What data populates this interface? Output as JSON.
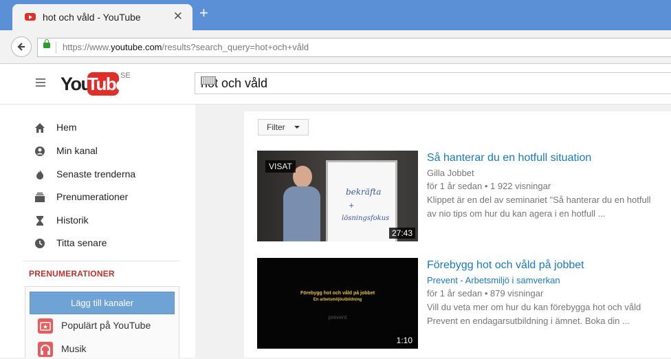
{
  "browser": {
    "tab_title": "hot och våld - YouTube",
    "tab_close": "✕",
    "new_tab": "+",
    "url_prefix": "https://www.",
    "url_domain": "youtube.com",
    "url_path": "/results?search_query=hot+och+våld"
  },
  "header": {
    "logo_you": "You",
    "logo_tube": "Tube",
    "logo_region": "SE",
    "search_value": "hot och våld"
  },
  "sidebar": {
    "items": [
      {
        "label": "Hem",
        "icon": "home-icon"
      },
      {
        "label": "Min kanal",
        "icon": "account-icon"
      },
      {
        "label": "Senaste trenderna",
        "icon": "flame-icon"
      },
      {
        "label": "Prenumerationer",
        "icon": "subscriptions-icon"
      },
      {
        "label": "Historik",
        "icon": "hourglass-icon"
      },
      {
        "label": "Titta senare",
        "icon": "clock-icon"
      }
    ],
    "subscriptions_heading": "PRENUMERATIONER",
    "add_channels_label": "Lägg till kanaler",
    "channels": [
      {
        "label": "Populärt på YouTube",
        "icon": "popular-icon"
      },
      {
        "label": "Musik",
        "icon": "headphones-icon"
      }
    ]
  },
  "results": {
    "filter_label": "Filter",
    "videos": [
      {
        "title": "Så hanterar du en hotfull situation",
        "channel": "Gilla Jobbet",
        "age": "för 1 år sedan",
        "views": "1 922 visningar",
        "description_1": "Klippet är en del av seminariet \"Så hanterar du en hotfull",
        "description_2": "av nio tips om hur du kan agera i en hotfull ...",
        "duration": "27:43",
        "watched_badge": "VISAT",
        "board_text_1": "bekräfta",
        "board_text_2": "lösningsfokus"
      },
      {
        "title": "Förebygg hot och våld på jobbet",
        "channel": "Prevent - Arbetsmiljö i samverkan",
        "age": "för 1 år sedan",
        "views": "879 visningar",
        "description_1": "Vill du veta mer om hur du kan förebygga hot och våld",
        "description_2": "Prevent en endagarsutbildning i ämnet. Boka din ...",
        "duration": "1:10",
        "thumb_line_1": "Förebygg hot och våld på jobbet",
        "thumb_line_2": "En arbetsmiljöutbildning",
        "thumb_logo": "prevent"
      }
    ]
  },
  "colors": {
    "brand_red": "#e52d27",
    "link_blue": "#167ac6",
    "tabbar_blue": "#5b8fd6"
  }
}
